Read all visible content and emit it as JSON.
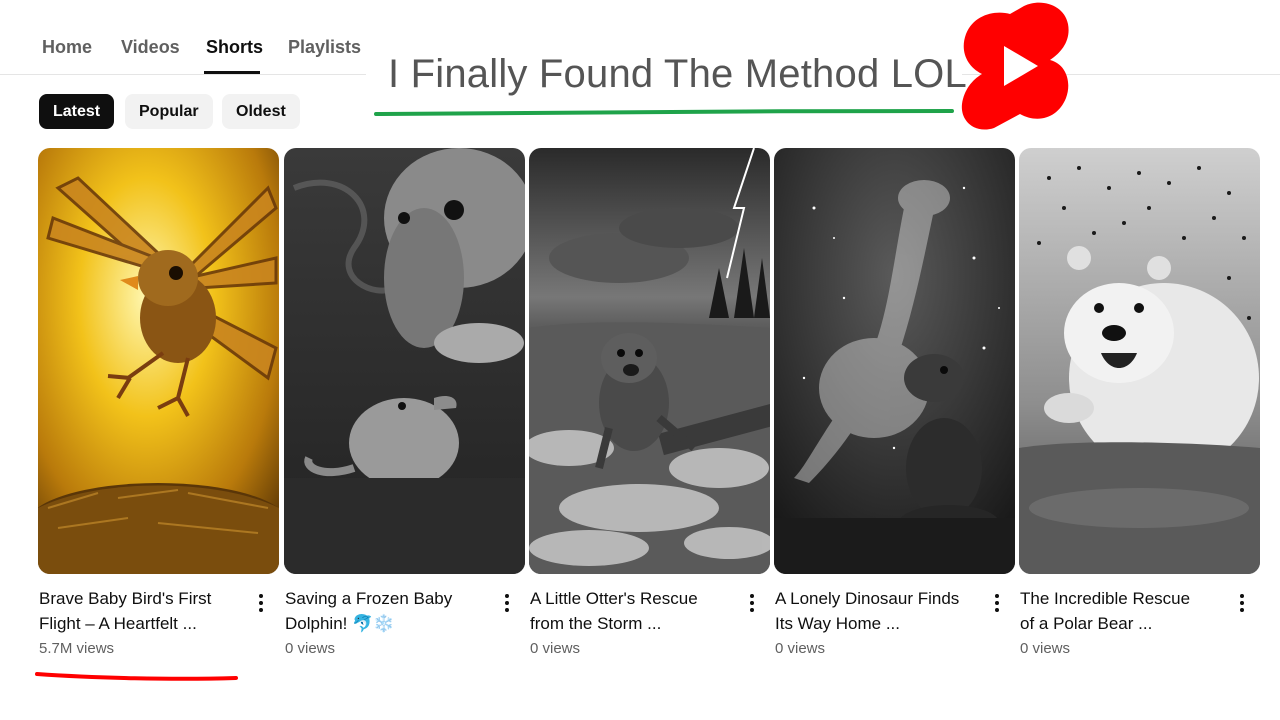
{
  "tabs": [
    {
      "label": "Home"
    },
    {
      "label": "Videos"
    },
    {
      "label": "Shorts"
    },
    {
      "label": "Playlists"
    }
  ],
  "active_tab": "Shorts",
  "filters": [
    {
      "label": "Latest"
    },
    {
      "label": "Popular"
    },
    {
      "label": "Oldest"
    }
  ],
  "active_filter": "Latest",
  "overlay": {
    "title": "I Finally Found The Method LOL",
    "underline_color": "#1fa34a",
    "logo_icon": "youtube-shorts-logo",
    "logo_color": "#ff0000"
  },
  "shorts": [
    {
      "title_line1": "Brave Baby Bird's First",
      "title_line2": "Flight – A Heartfelt ...",
      "views": "5.7M views",
      "thumb_icon": "baby-bird-thumbnail"
    },
    {
      "title_line1": "Saving a Frozen Baby",
      "title_line2": "Dolphin! 🐬❄️",
      "views": "0 views",
      "thumb_icon": "frozen-dolphin-thumbnail"
    },
    {
      "title_line1": "A Little Otter's Rescue",
      "title_line2": "from the Storm ...",
      "views": "0 views",
      "thumb_icon": "otter-storm-thumbnail"
    },
    {
      "title_line1": "A Lonely Dinosaur Finds",
      "title_line2": "Its Way Home ...",
      "views": "0 views",
      "thumb_icon": "lonely-dinosaur-thumbnail"
    },
    {
      "title_line1": "The Incredible Rescue",
      "title_line2": "of a Polar Bear ...",
      "views": "0 views",
      "thumb_icon": "polar-bear-thumbnail"
    }
  ],
  "annotation": {
    "underline_color": "#ff0000"
  },
  "colors": {
    "text": "#0f0f0f",
    "secondary": "#606060",
    "chip_bg": "#f2f2f2"
  }
}
